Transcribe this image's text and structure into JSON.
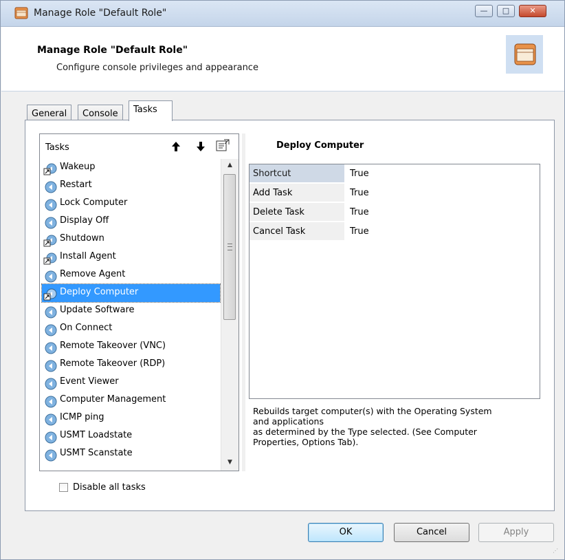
{
  "window": {
    "title": "Manage Role \"Default Role\"",
    "controls": {
      "minimize": "—",
      "maximize": "□",
      "close": "✕"
    }
  },
  "header": {
    "title": "Manage Role \"Default Role\"",
    "subtitle": "Configure console privileges and appearance",
    "icon": "window-icon"
  },
  "tabs": [
    {
      "label": "General",
      "active": false
    },
    {
      "label": "Console",
      "active": false
    },
    {
      "label": "Tasks",
      "active": true
    }
  ],
  "tasks_list": {
    "header": "Tasks",
    "header_icons": [
      "arrow-up-icon",
      "arrow-down-icon",
      "properties-icon"
    ],
    "items": [
      {
        "label": "Wakeup",
        "icon": "shortcut-task-icon"
      },
      {
        "label": "Restart",
        "icon": "task-icon"
      },
      {
        "label": "Lock Computer",
        "icon": "task-icon"
      },
      {
        "label": "Display Off",
        "icon": "task-icon"
      },
      {
        "label": "Shutdown",
        "icon": "shortcut-task-icon"
      },
      {
        "label": "Install Agent",
        "icon": "shortcut-task-icon"
      },
      {
        "label": "Remove Agent",
        "icon": "task-icon"
      },
      {
        "label": "Deploy Computer",
        "icon": "shortcut-task-icon",
        "selected": true
      },
      {
        "label": "Update Software",
        "icon": "task-icon"
      },
      {
        "label": "On Connect",
        "icon": "task-icon"
      },
      {
        "label": "Remote Takeover (VNC)",
        "icon": "task-icon"
      },
      {
        "label": "Remote Takeover (RDP)",
        "icon": "task-icon"
      },
      {
        "label": "Event Viewer",
        "icon": "task-icon"
      },
      {
        "label": "Computer Management",
        "icon": "task-icon"
      },
      {
        "label": "ICMP ping",
        "icon": "task-icon"
      },
      {
        "label": "USMT Loadstate",
        "icon": "task-icon"
      },
      {
        "label": "USMT Scanstate",
        "icon": "task-icon"
      }
    ],
    "scroll": {
      "up": "▲",
      "down": "▼"
    }
  },
  "disable_all": {
    "label": "Disable all tasks",
    "checked": false
  },
  "properties": {
    "title": "Deploy Computer",
    "rows": [
      {
        "name": "Shortcut",
        "value": "True"
      },
      {
        "name": "Add Task",
        "value": "True"
      },
      {
        "name": "Delete Task",
        "value": "True"
      },
      {
        "name": "Cancel Task",
        "value": "True"
      }
    ],
    "description": [
      "Rebuilds target computer(s) with the Operating System",
      "and applications",
      "as determined by the Type selected. (See Computer",
      "Properties, Options Tab)."
    ]
  },
  "buttons": {
    "ok": "OK",
    "cancel": "Cancel",
    "apply": "Apply"
  },
  "colors": {
    "selection": "#3399ff",
    "title_bar": "#c4d5ea",
    "shortcut_header": "#cfd9e6"
  }
}
